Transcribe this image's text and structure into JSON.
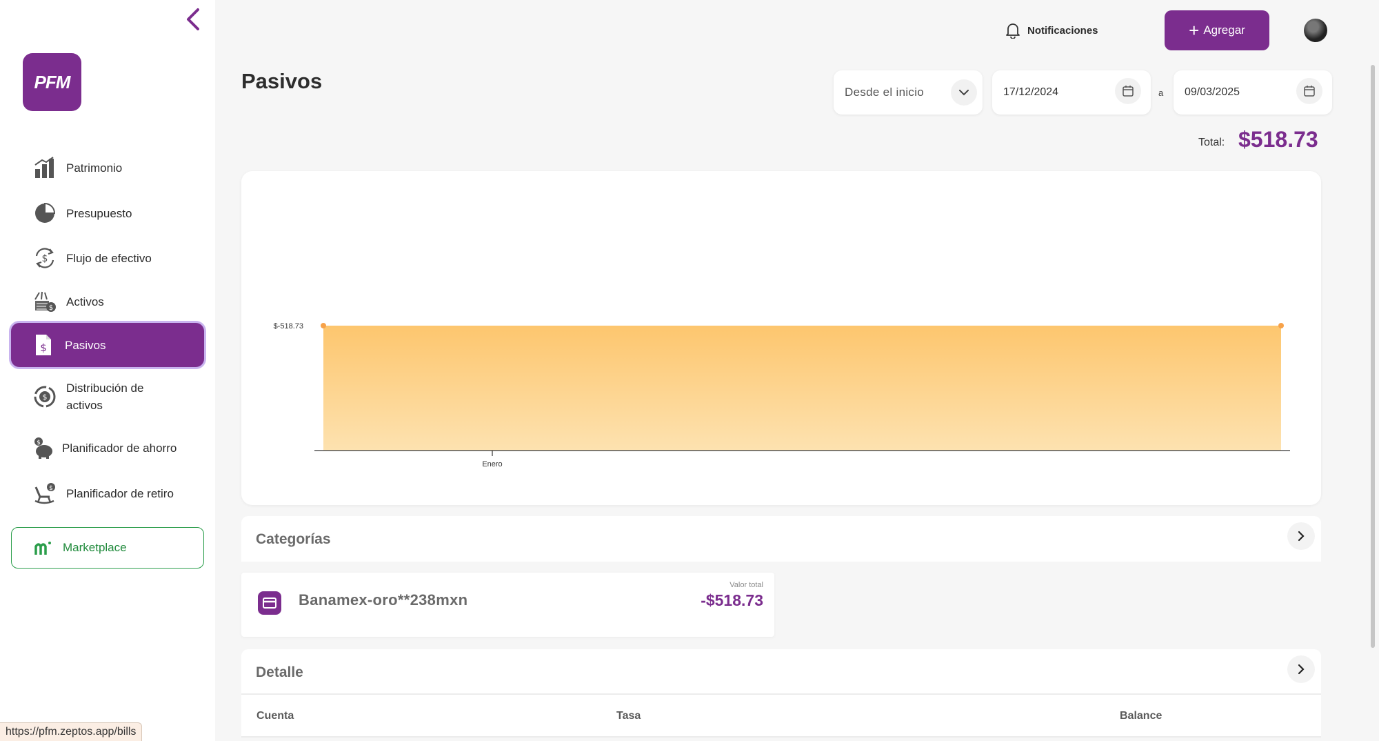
{
  "sidebar": {
    "logo_text": "PFM",
    "items": [
      {
        "label": "Patrimonio",
        "icon": "bar-chart-icon"
      },
      {
        "label": "Presupuesto",
        "icon": "pie-chart-icon"
      },
      {
        "label": "Flujo de efectivo",
        "icon": "cash-flow-icon"
      },
      {
        "label": "Activos",
        "icon": "assets-icon"
      },
      {
        "label": "Pasivos",
        "icon": "liabilities-document-icon",
        "active": true
      },
      {
        "label": "Distribución de activos",
        "icon": "asset-distribution-icon"
      },
      {
        "label": "Planificador de ahorro",
        "icon": "piggy-bank-icon"
      },
      {
        "label": "Planificador de retiro",
        "icon": "rocking-chair-icon"
      }
    ],
    "marketplace_label": "Marketplace"
  },
  "header": {
    "notifications_label": "Notificaciones",
    "add_label": "Agregar"
  },
  "page": {
    "title": "Pasivos",
    "period": "Desde el inicio",
    "date_from": "17/12/2024",
    "date_separator": "a",
    "date_to": "09/03/2025",
    "total_label": "Total:",
    "total_value": "$518.73"
  },
  "chart_data": {
    "type": "area",
    "x": [
      "Enero"
    ],
    "series": [
      {
        "values": [
          -518.73,
          -518.73
        ]
      }
    ],
    "y_label_text": "$-518.73",
    "tick_labels": [
      "Enero"
    ],
    "fill_color": "#fdc66e",
    "point_color": "#f7a24a",
    "grid": false
  },
  "categories": {
    "title": "Categorías",
    "items": [
      {
        "name": "Banamex-oro**238mxn",
        "sub_label": "Valor total",
        "value": "-$518.73"
      }
    ]
  },
  "detail": {
    "title": "Detalle",
    "columns": [
      "Cuenta",
      "Tasa",
      "Balance"
    ]
  },
  "status_url": "https://pfm.zeptos.app/bills",
  "colors": {
    "brand": "#7b2d8e",
    "marketplace": "#2a9d4a"
  }
}
